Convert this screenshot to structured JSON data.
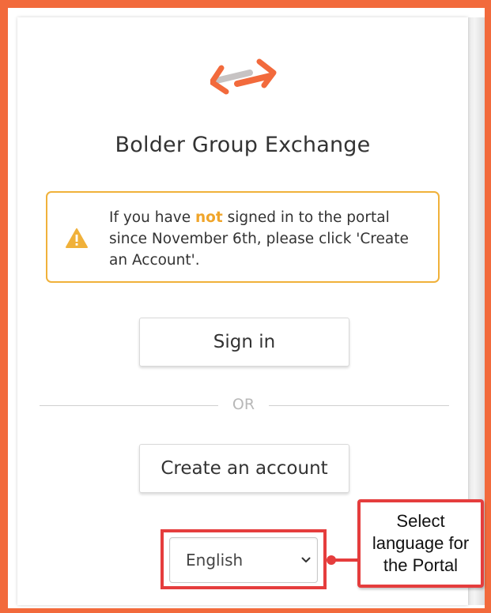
{
  "app": {
    "title": "Bolder Group Exchange"
  },
  "notice": {
    "before": "If you have ",
    "highlight": "not",
    "after": " signed in to the portal since November 6th, please click 'Create an Account'."
  },
  "buttons": {
    "sign_in": "Sign in",
    "separator": "OR",
    "create_account": "Create an account"
  },
  "language": {
    "selected": "English"
  },
  "callout": {
    "line1": "Select",
    "line2": "language for",
    "line3": "the Portal"
  },
  "colors": {
    "frame": "#f26a3c",
    "warning": "#f0b13a",
    "highlight_red": "#e53d3d",
    "logo_gray": "#c7c3c3"
  },
  "icons": {
    "logo": "exchange-arrows-icon",
    "notice": "warning-triangle-icon",
    "select": "chevron-down-icon"
  }
}
